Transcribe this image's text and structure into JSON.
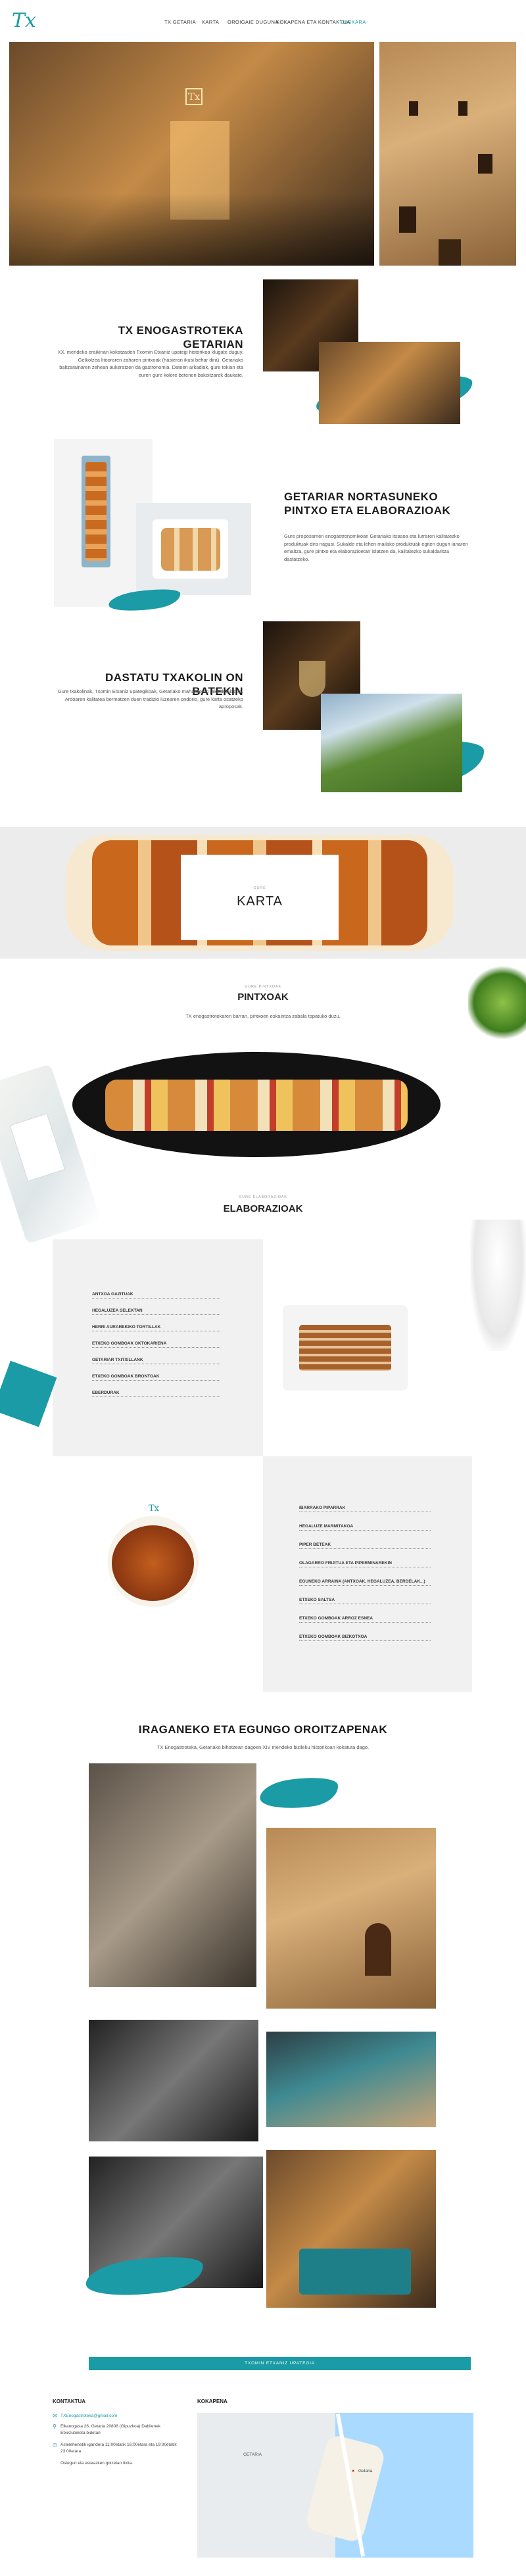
{
  "brand": {
    "logo_text": "Tx",
    "accent": "#1a9ba5"
  },
  "nav": {
    "items": [
      {
        "label": "TX GETARIA",
        "active": false
      },
      {
        "label": "KARTA",
        "active": false
      },
      {
        "label": "OROIGAIE DUGUNA",
        "active": false
      },
      {
        "label": "KOKAPENA ETA KONTAKTUA",
        "active": false
      },
      {
        "label": "EUSKARA",
        "active": true
      }
    ]
  },
  "intro": {
    "title": "TX ENOGASTROTEKA GETARIAN",
    "text": "XX. mendeko eraikinan kokatzaden Txomin Etxaniz upategi historikoa klugate duguy. Gelkolzea litooraren zaharen pintxoak (hasieran ikusi behar dira), Getariako baltzarainaren zehean aukeratzen da gastronomia. Dateen arkadiak, gure tokian eta euren gure kolore betenen bakoitzarek daukate."
  },
  "pintxo_section": {
    "title": "GETARIAR NORTASUNEKO PINTXO ETA ELABORAZIOAK",
    "text": "Gure proposamen enogastronomikoan Getariako itsasoa eta lurraren kalitatezko produktuak dira nagusi. Sukalde eta lehen mailako produktuak egiten dugun lanaren emaitza, gure pintxo eta elaborazioetan islatzen da, kalitatezko sukaldaritza dastatzeko."
  },
  "txakoli_section": {
    "title": "DASTATU TXAKOLIN ON BATEKIN",
    "text": "Gure txakolinak, Txomin Etxaniz upategikoak, Getariako mahastietan jaiotakoak dira. Ardoaren kalitatea bermatzen duen tradizio luzearen ondorio, gure karta osatzeko aproposak."
  },
  "karta": {
    "eyebrow": "GURE",
    "title": "KARTA"
  },
  "pintxoak": {
    "eyebrow": "GURE PINTXOAK",
    "title": "PINTXOAK",
    "text": "TX enogastrotekaren barran, pintxoen eskaintza zabala topatuko duzu."
  },
  "elaborazioak": {
    "eyebrow": "GURE ELABORAZIOAK",
    "title": "ELABORAZIOAK",
    "list_a": [
      "ANTXOA GAZITUAK",
      "HEGALUZEA SELEKTAN",
      "HERRI AURAREKIKO TORTILLAK",
      "ETXEKO GOMBOAK OKTOKARIENA",
      "GETARIAR TXITXILLANK",
      "ETXEKO GOMBOAK BRONTOAK",
      "EBERDURAK"
    ],
    "list_b": [
      "IBARRAKO PIPARRAK",
      "HEGALUZE MARMITAKOA",
      "PIPER BETEAK",
      "OLAGARRO FRIJITUA ETA PIPERMINAREKIN",
      "EGUNEKO ARRAINA (ANTXOAK, HEGALUZEA, BERDELAK...)",
      "ETXEKO SALTSA",
      "ETXEKO GOMBOAK ARROZ ESNEA",
      "ETXEKO GOMBOAK BIZKOTXOA"
    ]
  },
  "memories": {
    "title": "IRAGANEKO ETA EGUNGO OROITZAPENAK",
    "text": "TX Enogastroteka, Getariako bihotzean dagoen XIV mendeko bizileku historikoan kokatuta dago.",
    "cta_label": "TXOMIN ETXANIZ UPATEGIA"
  },
  "footer": {
    "contact_title": "KONTAKTUA",
    "location_title": "KOKAPENA",
    "phone": "TXEnogastroteka@gmail.com",
    "address": "Elkanogasa 26, Getaria 20808 (Gipuzkoa) Dabilenek Etxezubirieta bidetan",
    "hours": "Astelehenetik igandera 11:00etatik 16:00etara eta 19:00etatik 23:00etara",
    "note": "Ostegun eta asteazken goizetan itxita.",
    "map_labels": [
      "GETARIA",
      "Getaria"
    ]
  }
}
